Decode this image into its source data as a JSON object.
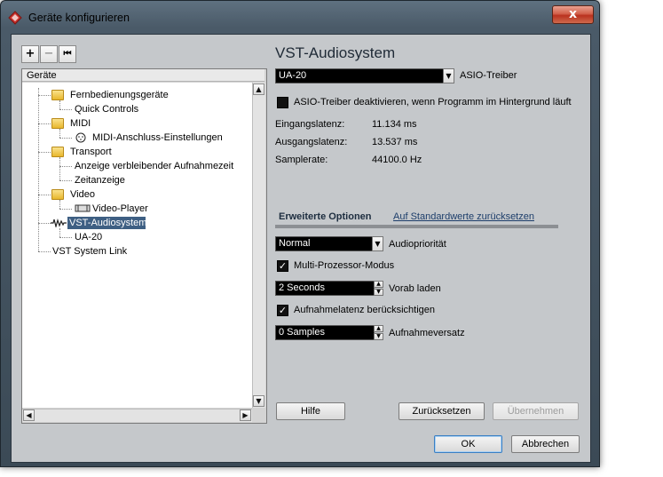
{
  "window": {
    "title": "Geräte konfigurieren",
    "close_label": "x"
  },
  "toolbar": {
    "add_label": "+",
    "remove_label": "−",
    "reset_label": "⏮"
  },
  "tree": {
    "header": "Geräte",
    "items": [
      {
        "label": "Fernbedienungsgeräte",
        "type": "folder"
      },
      {
        "label": "Quick Controls",
        "type": "item"
      },
      {
        "label": "MIDI",
        "type": "folder"
      },
      {
        "label": "MIDI-Anschluss-Einstellungen",
        "type": "item",
        "icon": "midi-port-icon"
      },
      {
        "label": "Transport",
        "type": "folder"
      },
      {
        "label": "Anzeige verbleibender Aufnahmezeit",
        "type": "item"
      },
      {
        "label": "Zeitanzeige",
        "type": "item"
      },
      {
        "label": "Video",
        "type": "folder"
      },
      {
        "label": "Video-Player",
        "type": "item",
        "icon": "video-icon"
      },
      {
        "label": "VST-Audiosystem",
        "type": "item",
        "icon": "audio-system-icon",
        "selected": true
      },
      {
        "label": "UA-20",
        "type": "item"
      },
      {
        "label": "VST System Link",
        "type": "item"
      }
    ]
  },
  "panel": {
    "title": "VST-Audiosystem",
    "driver": {
      "value": "UA-20",
      "label": "ASIO-Treiber"
    },
    "deactivate_checkbox": {
      "label": "ASIO-Treiber deaktivieren, wenn Programm im Hintergrund läuft",
      "checked": false
    },
    "info": [
      {
        "label": "Eingangslatenz:",
        "value": "11.134 ms"
      },
      {
        "label": "Ausgangslatenz:",
        "value": "13.537 ms"
      },
      {
        "label": "Samplerate:",
        "value": "44100.0 Hz"
      }
    ],
    "tabs": {
      "active": "Erweiterte Optionen",
      "link": "Auf Standardwerte zurücksetzen"
    },
    "priority": {
      "value": "Normal",
      "label": "Audiopriorität"
    },
    "multiprocessor": {
      "label": "Multi-Prozessor-Modus",
      "checked": true
    },
    "preload": {
      "value": "2 Seconds",
      "label": "Vorab laden"
    },
    "latency_checkbox": {
      "label": "Aufnahmelatenz berücksichtigen",
      "checked": true
    },
    "offset": {
      "value": "0 Samples",
      "label": "Aufnahmeversatz"
    }
  },
  "buttons": {
    "help": "Hilfe",
    "reset": "Zurücksetzen",
    "apply": "Übernehmen",
    "ok": "OK",
    "cancel": "Abbrechen"
  },
  "colors": {
    "selection": "#3e5f83",
    "window_frame": "#4a5a68",
    "client_bg": "#c5c8cb"
  }
}
